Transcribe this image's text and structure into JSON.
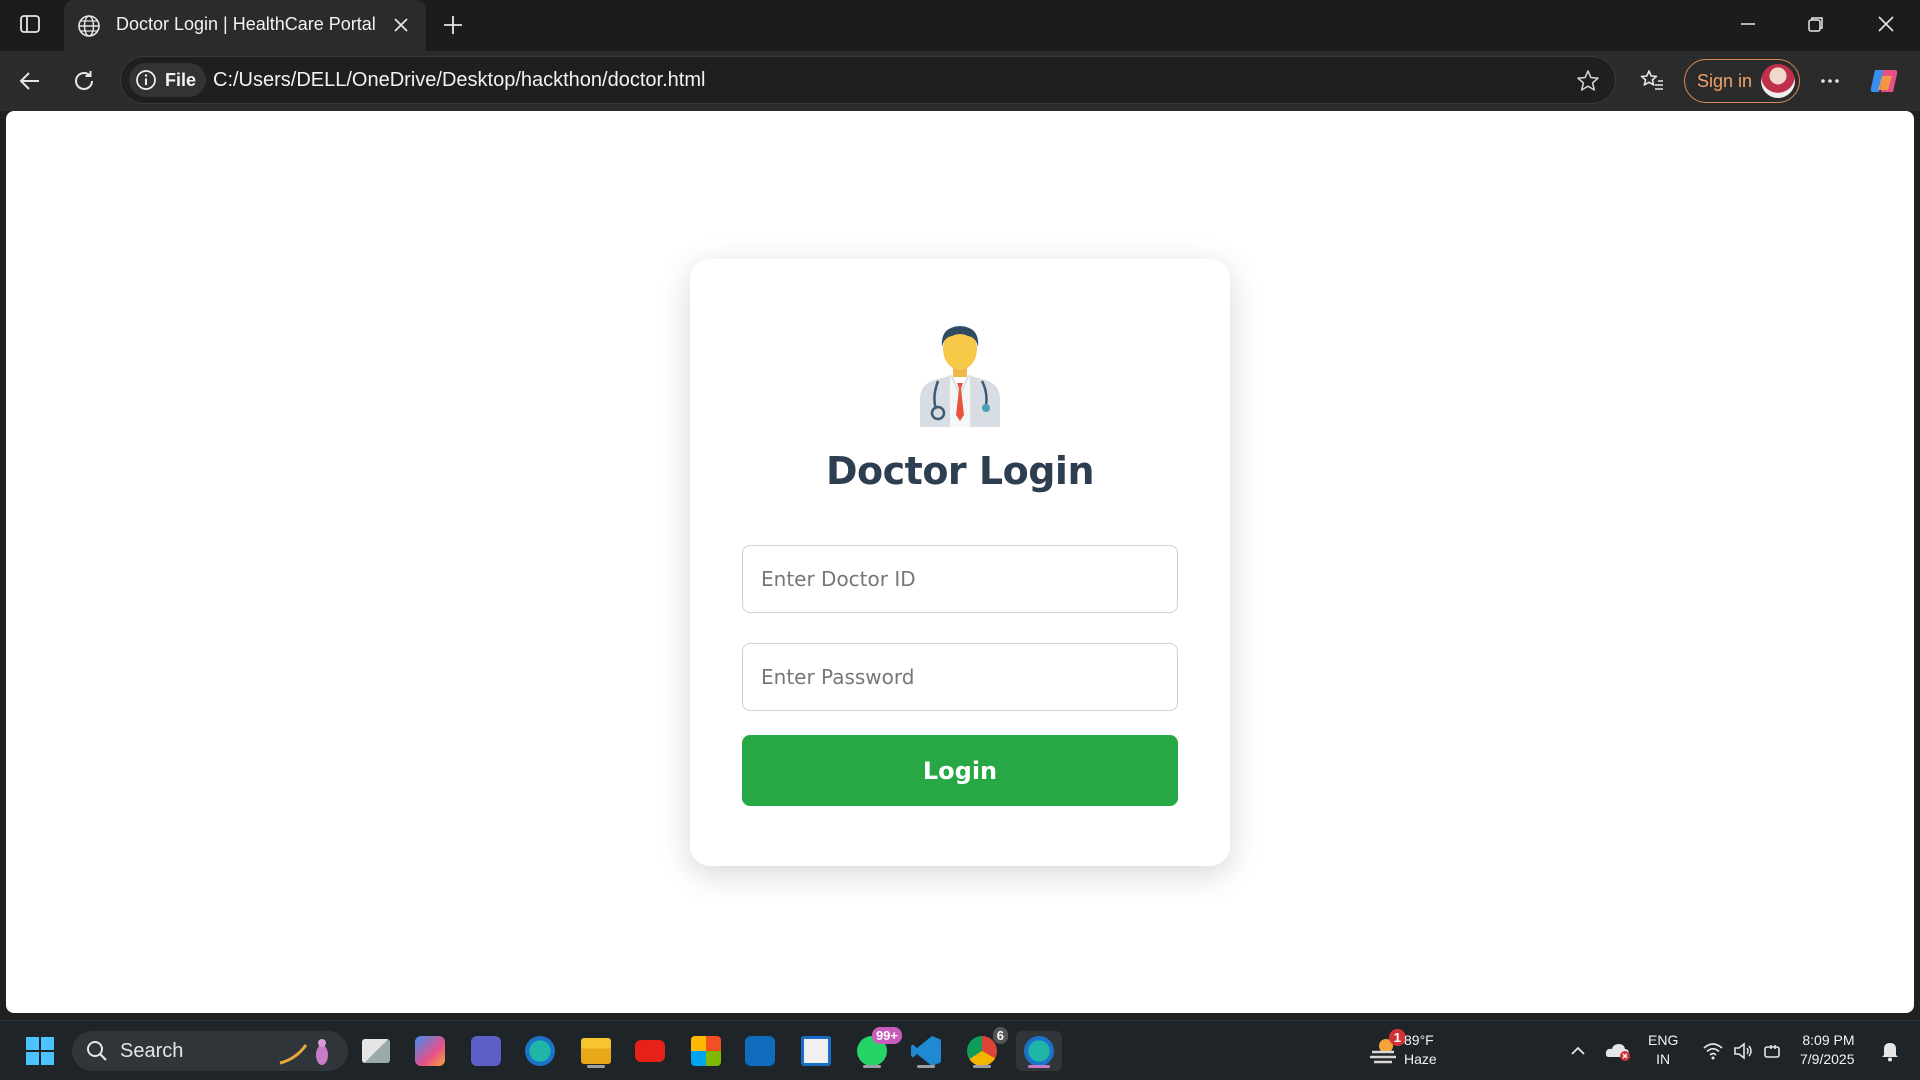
{
  "browser": {
    "tab_title": "Doctor Login | HealthCare Portal",
    "site_chip": "File",
    "url": "C:/Users/DELL/OneDrive/Desktop/hackthon/doctor.html",
    "sign_in_label": "Sign in"
  },
  "page": {
    "heading": "Doctor Login",
    "doctor_id_placeholder": "Enter Doctor ID",
    "password_placeholder": "Enter Password",
    "login_label": "Login",
    "accent_color": "#28a745",
    "heading_color": "#2c3e50"
  },
  "taskbar": {
    "search_label": "Search",
    "whatsapp_badge": "99+",
    "chrome_badge": "6",
    "weather_badge": "1",
    "weather_temp": "89°F",
    "weather_desc": "Haze",
    "lang_top": "ENG",
    "lang_bottom": "IN",
    "time": "8:09 PM",
    "date": "7/9/2025"
  }
}
